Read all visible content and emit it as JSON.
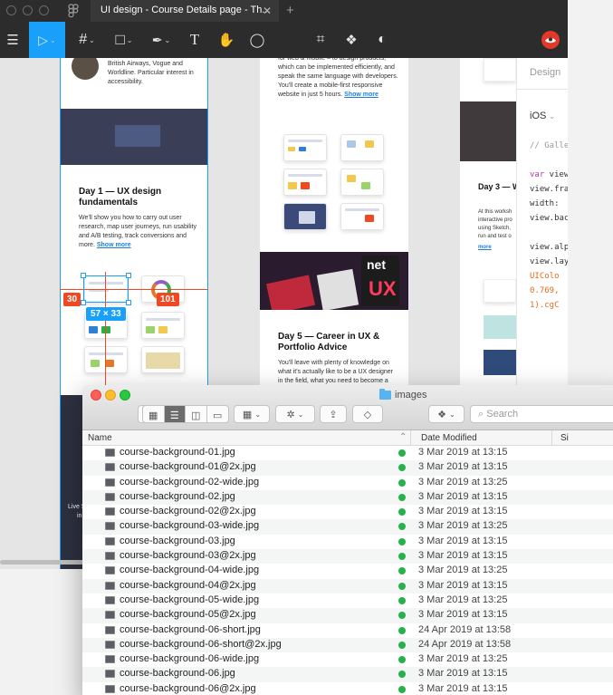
{
  "titlebar": {
    "tab_title": "UI design - Course Details page - Th...",
    "tab_close": "✕",
    "new_tab": "+"
  },
  "toolbar": {
    "menu_glyph": "☰",
    "move_glyph": "▷",
    "frame_glyph": "#",
    "shape_glyph": "□",
    "pen_glyph": "✒",
    "text_glyph": "T",
    "hand_glyph": "✋",
    "comment_glyph": "◯",
    "crop_glyph": "⌗",
    "component_glyph": "❖",
    "contrast_glyph": "◐",
    "chevron": "⌄",
    "accent": "#18a0fb"
  },
  "canvas": {
    "col1": {
      "bio_text": "British Airways, Vogue and Worldline. Particular interest in accessibility.",
      "day_heading": "Day 1 — UX design fundamentals",
      "day_body": "We'll show you how to carry out user research, map user journeys, run usability and A/B testing, track conversions and more.",
      "show_more": "Show more",
      "badge_left": "30",
      "badge_right": "101",
      "badge_size": "57 × 33",
      "promo_left": "Live S",
      "promo_left2": "in"
    },
    "col2": {
      "top_text": "for web & mobile – to design products, which can be implemented efficiently, and speak the same language with developers. You'll create a mobile-first responsive website in just 5 hours.",
      "show_more": "Show more",
      "day5_heading": "Day 5 — Career in UX & Portfolio Advice",
      "day5_body": "You'll leave with plenty of knowledge on what it's actually like to be a UX designer in the field, what you need to become a",
      "banner_text_1": "net",
      "banner_text_2": "UX"
    },
    "col3": {
      "day3_heading": "Day 3 — W Rapid Pro",
      "day3_body": "At this worksh interactive pro using Sketch, run and test o",
      "sketch_link": "Sketch",
      "more": "more"
    }
  },
  "right_panel": {
    "tab": "Design",
    "platform": "iOS",
    "code_lines": [
      "// Galle",
      "var view",
      "view.fra",
      "  width:",
      "view.bac",
      "view.alp",
      "view.lay",
      "  UIColo",
      "  0.769,",
      "  1).cgC"
    ]
  },
  "finder": {
    "title": "images",
    "search_placeholder": "Search",
    "columns": {
      "name": "Name",
      "date": "Date Modified",
      "size": "Si"
    },
    "sort_glyph": "⌃",
    "back": "‹",
    "forward": "›",
    "files": [
      {
        "name": "course-background-01.jpg",
        "date": "3 Mar 2019 at 13:15"
      },
      {
        "name": "course-background-01@2x.jpg",
        "date": "3 Mar 2019 at 13:15"
      },
      {
        "name": "course-background-02-wide.jpg",
        "date": "3 Mar 2019 at 13:25"
      },
      {
        "name": "course-background-02.jpg",
        "date": "3 Mar 2019 at 13:15"
      },
      {
        "name": "course-background-02@2x.jpg",
        "date": "3 Mar 2019 at 13:15"
      },
      {
        "name": "course-background-03-wide.jpg",
        "date": "3 Mar 2019 at 13:25"
      },
      {
        "name": "course-background-03.jpg",
        "date": "3 Mar 2019 at 13:15"
      },
      {
        "name": "course-background-03@2x.jpg",
        "date": "3 Mar 2019 at 13:15"
      },
      {
        "name": "course-background-04-wide.jpg",
        "date": "3 Mar 2019 at 13:25"
      },
      {
        "name": "course-background-04@2x.jpg",
        "date": "3 Mar 2019 at 13:15"
      },
      {
        "name": "course-background-05-wide.jpg",
        "date": "3 Mar 2019 at 13:25"
      },
      {
        "name": "course-background-05@2x.jpg",
        "date": "3 Mar 2019 at 13:15"
      },
      {
        "name": "course-background-06-short.jpg",
        "date": "24 Apr 2019 at 13:58"
      },
      {
        "name": "course-background-06-short@2x.jpg",
        "date": "24 Apr 2019 at 13:58"
      },
      {
        "name": "course-background-06-wide.jpg",
        "date": "3 Mar 2019 at 13:25"
      },
      {
        "name": "course-background-06.jpg",
        "date": "3 Mar 2019 at 13:15"
      },
      {
        "name": "course-background-06@2x.jpg",
        "date": "3 Mar 2019 at 13:15"
      }
    ]
  }
}
